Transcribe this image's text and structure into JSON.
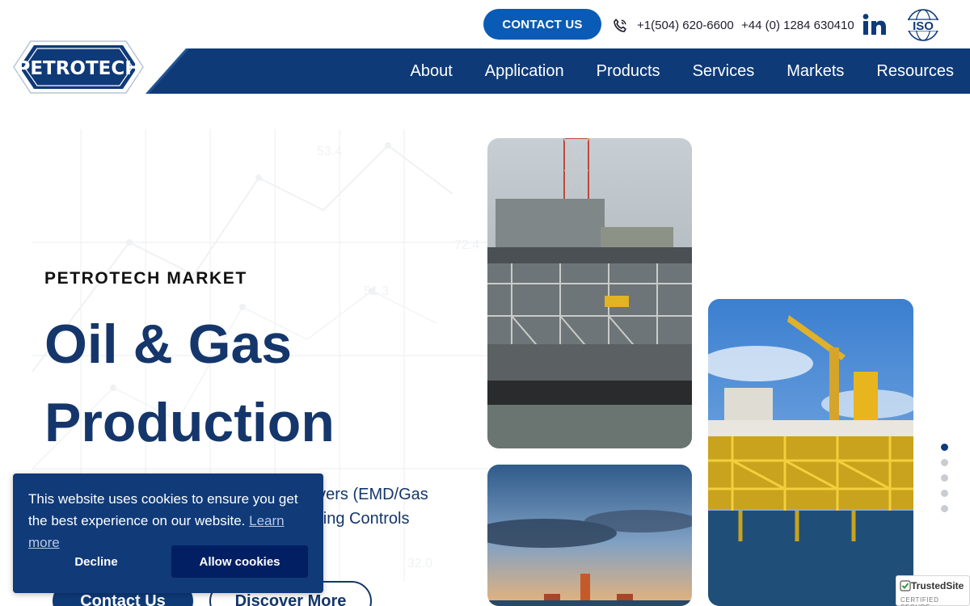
{
  "topbar": {
    "contact_label": "CONTACT US",
    "phone_us": "+1(504) 620-6600",
    "phone_uk": "+44 (0) 1284 630410",
    "linkedin_label": "in",
    "iso_label": "ISO"
  },
  "logo": {
    "text": "PETROTECH"
  },
  "nav": {
    "items": [
      {
        "label": "About"
      },
      {
        "label": "Application"
      },
      {
        "label": "Products"
      },
      {
        "label": "Services"
      },
      {
        "label": "Markets"
      },
      {
        "label": "Resources"
      }
    ]
  },
  "hero": {
    "eyebrow": "PETROTECH MARKET",
    "title_line1": "Oil & Gas",
    "title_line2": "Production",
    "desc_line1": "rivers (EMD/Gas",
    "desc_line2": "aring Controls",
    "primary_button": "Contact Us",
    "secondary_button": "Discover More",
    "background_graph_labels": [
      "53.4",
      "72.4",
      "51.3",
      "32.0"
    ]
  },
  "carousel": {
    "dot_count": 5,
    "active_index": 0
  },
  "cookie": {
    "message": "This website uses cookies to ensure you get the best experience on our website.",
    "learn_more": "Learn more",
    "decline_label": "Decline",
    "allow_label": "Allow cookies"
  },
  "trusted_site": {
    "title": "TrustedSite",
    "subtitle": "CERTIFIED SECURE"
  },
  "colors": {
    "brand_navy": "#0f3a78",
    "contact_blue": "#0a5bb5",
    "headline": "#14366b"
  }
}
